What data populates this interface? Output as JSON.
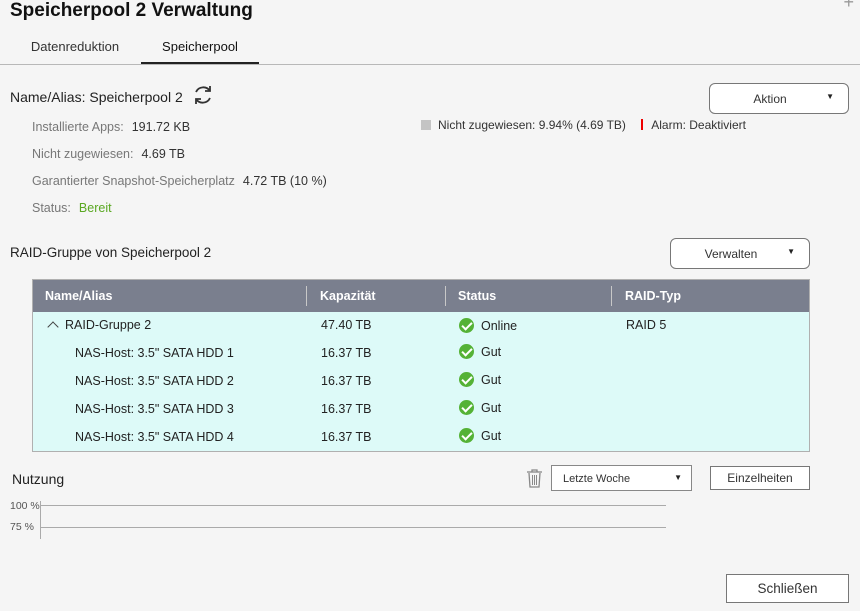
{
  "window": {
    "title": "Speicherpool 2 Verwaltung"
  },
  "tabs": [
    {
      "label": "Datenreduktion",
      "active": false
    },
    {
      "label": "Speicherpool",
      "active": true
    }
  ],
  "pool": {
    "name_label": "Name/Alias: Speicherpool 2",
    "action_button": "Aktion",
    "info": {
      "apps_label": "Installierte Apps:",
      "apps_value": "191.72 KB",
      "unassigned_label": "Nicht zugewiesen:",
      "unassigned_value": "4.69 TB",
      "snapshot_label": "Garantierter Snapshot-Speicherplatz",
      "snapshot_value": "4.72 TB (10 %)",
      "status_label": "Status:",
      "status_value": "Bereit"
    },
    "legend": {
      "unassigned_label": "Nicht zugewiesen:",
      "unassigned_value": "9.94% (4.69 TB)",
      "alarm_label": "Alarm:",
      "alarm_value": "Deaktiviert"
    }
  },
  "raid": {
    "title": "RAID-Gruppe von Speicherpool 2",
    "manage_button": "Verwalten",
    "columns": [
      "Name/Alias",
      "Kapazität",
      "Status",
      "RAID-Typ"
    ],
    "group": {
      "name": "RAID-Gruppe 2",
      "capacity": "47.40 TB",
      "status": "Online",
      "type": "RAID 5"
    },
    "disks": [
      {
        "name": "NAS-Host: 3.5\" SATA HDD 1",
        "capacity": "16.37 TB",
        "status": "Gut"
      },
      {
        "name": "NAS-Host: 3.5\" SATA HDD 2",
        "capacity": "16.37 TB",
        "status": "Gut"
      },
      {
        "name": "NAS-Host: 3.5\" SATA HDD 3",
        "capacity": "16.37 TB",
        "status": "Gut"
      },
      {
        "name": "NAS-Host: 3.5\" SATA HDD 4",
        "capacity": "16.37 TB",
        "status": "Gut"
      }
    ]
  },
  "usage": {
    "title": "Nutzung",
    "period_select": "Letzte Woche",
    "details_button": "Einzelheiten",
    "y_ticks": [
      "100 %",
      "75 %"
    ]
  },
  "footer": {
    "close_button": "Schließen"
  },
  "colors": {
    "status_ok": "#5aa822",
    "table_bg": "#ddfaf8",
    "header_bg": "#7a7f8e",
    "alarm_marker": "#e00000"
  },
  "icons": [
    "refresh-icon",
    "trash-icon",
    "check-circle-icon",
    "chevron-up-icon",
    "caret-down-icon",
    "plus-icon"
  ]
}
